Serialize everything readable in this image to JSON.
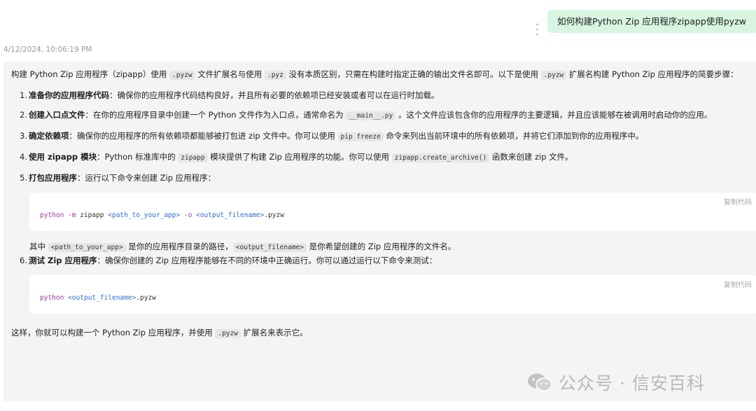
{
  "user_message": "如何构建Python Zip 应用程序zipapp使用pyzw",
  "timestamp": "4/12/2024, 10:06:19 PM",
  "answer": {
    "intro_a": "构建 Python Zip 应用程序（zipapp）使用 ",
    "intro_code1": ".pyzw",
    "intro_b": " 文件扩展名与使用 ",
    "intro_code2": ".pyz",
    "intro_c": " 没有本质区别，只需在构建时指定正确的输出文件名即可。以下是使用 ",
    "intro_code3": ".pyzw",
    "intro_d": " 扩展名构建 Python Zip 应用程序的简要步骤：",
    "steps": [
      {
        "num": "1.",
        "title": "准备你的应用程序代码",
        "text": "：确保你的应用程序代码结构良好，并且所有必要的依赖项已经安装或者可以在运行时加载。"
      },
      {
        "num": "2.",
        "title": "创建入口点文件",
        "text_a": "：在你的应用程序目录中创建一个 Python 文件作为入口点，通常命名为 ",
        "code": "__main__.py",
        "text_b": " 。这个文件应该包含你的应用程序的主要逻辑，并且应该能够在被调用时启动你的应用。"
      },
      {
        "num": "3.",
        "title": "确定依赖项",
        "text_a": "：确保你的应用程序的所有依赖项都能够被打包进 zip 文件中。你可以使用 ",
        "code": "pip freeze",
        "text_b": " 命令来列出当前环境中的所有依赖项，并将它们添加到你的应用程序中。"
      },
      {
        "num": "4.",
        "title": "使用 zipapp 模块",
        "text_a": "：Python 标准库中的 ",
        "code": "zipapp",
        "text_b": " 模块提供了构建 Zip 应用程序的功能。你可以使用 ",
        "code2": "zipapp.create_archive()",
        "text_c": " 函数来创建 zip 文件。"
      },
      {
        "num": "5.",
        "title": "打包应用程序",
        "text": "：运行以下命令来创建 Zip 应用程序："
      },
      {
        "num": "6.",
        "title": "测试 Zip 应用程序",
        "text": "：确保你创建的 Zip 应用程序能够在不同的环境中正确运行。你可以通过运行以下命令来测试："
      }
    ],
    "code1": {
      "copy": "复制代码",
      "kw": "python -m",
      "plain1": " zipapp ",
      "arg1": "<path_to_your_app>",
      "kw2": " -o ",
      "arg2": "<output_filename>",
      "plain2": ".pyzw"
    },
    "note": {
      "code1": "<path_to_your_app>",
      "text_a": " 是你的应用程序目录的路径，",
      "code2": "<output_filename>",
      "text_b": " 是你希望创建的 Zip 应用程序的文件名。",
      "prefix": "其中 "
    },
    "code2": {
      "copy": "复制代码",
      "kw": "python",
      "plain1": " ",
      "arg1": "<output_filename>",
      "plain2": ".pyzw"
    },
    "outro_a": "这样，你就可以构建一个 Python Zip 应用程序，并使用 ",
    "outro_code": ".pyzw",
    "outro_b": " 扩展名来表示它。"
  },
  "watermark": "公众号 · 信安百科"
}
